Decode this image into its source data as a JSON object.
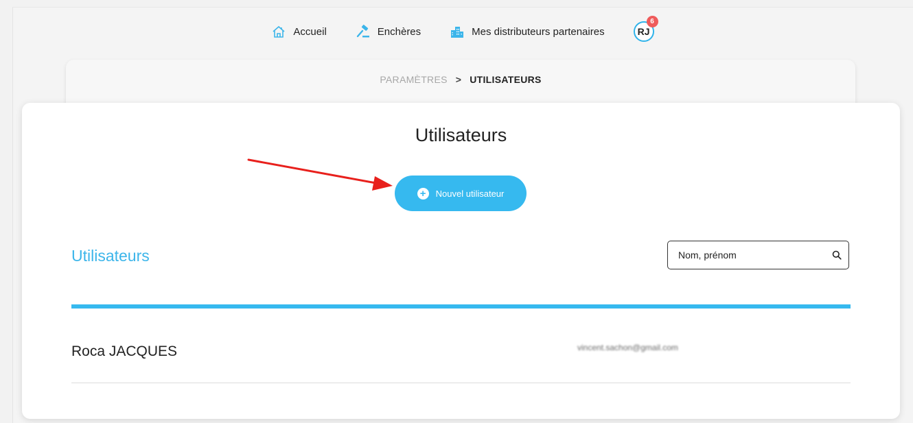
{
  "nav": {
    "items": [
      {
        "label": "Accueil",
        "icon": "home-icon"
      },
      {
        "label": "Enchères",
        "icon": "gavel-icon"
      },
      {
        "label": "Mes distributeurs partenaires",
        "icon": "buildings-icon"
      }
    ],
    "avatar_initials": "RJ",
    "notification_count": "6"
  },
  "breadcrumb": {
    "parent": "PARAMÈTRES",
    "separator": ">",
    "current": "UTILISATEURS"
  },
  "page": {
    "title": "Utilisateurs",
    "new_user_label": "Nouvel utilisateur"
  },
  "users_section": {
    "title": "Utilisateurs",
    "search_placeholder": "Nom, prénom",
    "rows": [
      {
        "name": "Roca JACQUES",
        "email": "vincent.sachon@gmail.com"
      }
    ]
  },
  "colors": {
    "accent": "#36b9ef",
    "badge": "#ef5b5b",
    "annotation_arrow": "#e8201c"
  }
}
